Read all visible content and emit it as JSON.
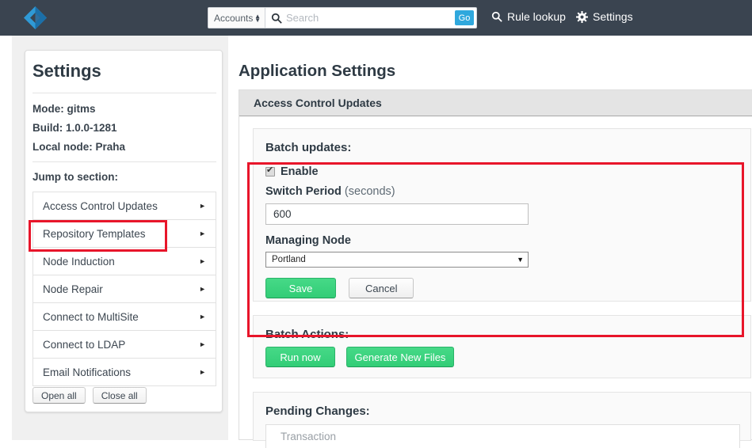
{
  "topbar": {
    "logo_icon": "diamond-logo-icon",
    "search": {
      "scope_value": "Accounts",
      "search_icon": "search-icon",
      "placeholder": "Search",
      "go_label": "Go"
    },
    "links": [
      {
        "icon": "search-icon",
        "label": "Rule lookup"
      },
      {
        "icon": "gear-icon",
        "label": "Settings"
      }
    ]
  },
  "sidebar": {
    "title": "Settings",
    "meta": {
      "mode": "Mode: gitms",
      "build": "Build: 1.0.0-1281",
      "local_node": "Local node: Praha"
    },
    "jump_label": "Jump to section:",
    "items": [
      {
        "label": "Access Control Updates",
        "caret": "►"
      },
      {
        "label": "Repository Templates",
        "caret": "►"
      },
      {
        "label": "Node Induction",
        "caret": "►"
      },
      {
        "label": "Node Repair",
        "caret": "►"
      },
      {
        "label": "Connect to MultiSite",
        "caret": "►"
      },
      {
        "label": "Connect to LDAP",
        "caret": "►"
      },
      {
        "label": "Email Notifications",
        "caret": "►"
      }
    ],
    "open_all": "Open all",
    "close_all": "Close all"
  },
  "main": {
    "title": "Application Settings",
    "panel_header": "Access Control Updates",
    "batch_updates": {
      "title": "Batch updates:",
      "enable_label": "Enable",
      "enable_checked": true,
      "switch_period_label": "Switch Period",
      "switch_period_unit": "(seconds)",
      "switch_period_value": "600",
      "managing_node_label": "Managing Node",
      "managing_node_value": "Portland",
      "managing_node_caret": "▼",
      "save_label": "Save",
      "cancel_label": "Cancel"
    },
    "batch_actions": {
      "title": "Batch Actions:",
      "run_now_label": "Run now",
      "generate_label": "Generate New Files"
    },
    "pending_changes": {
      "title": "Pending Changes:",
      "columns": [
        "Transaction"
      ]
    }
  },
  "annotations": {
    "color": "#e8152a",
    "boxes": [
      "sidebar-item-access-control-updates",
      "batch-updates-form"
    ]
  },
  "colors": {
    "navbar": "#3a4450",
    "accent_blue": "#2fa8dd",
    "accent_green": "#32cd77",
    "annotation_red": "#e8152a",
    "page_bg": "#f0f0f0"
  }
}
